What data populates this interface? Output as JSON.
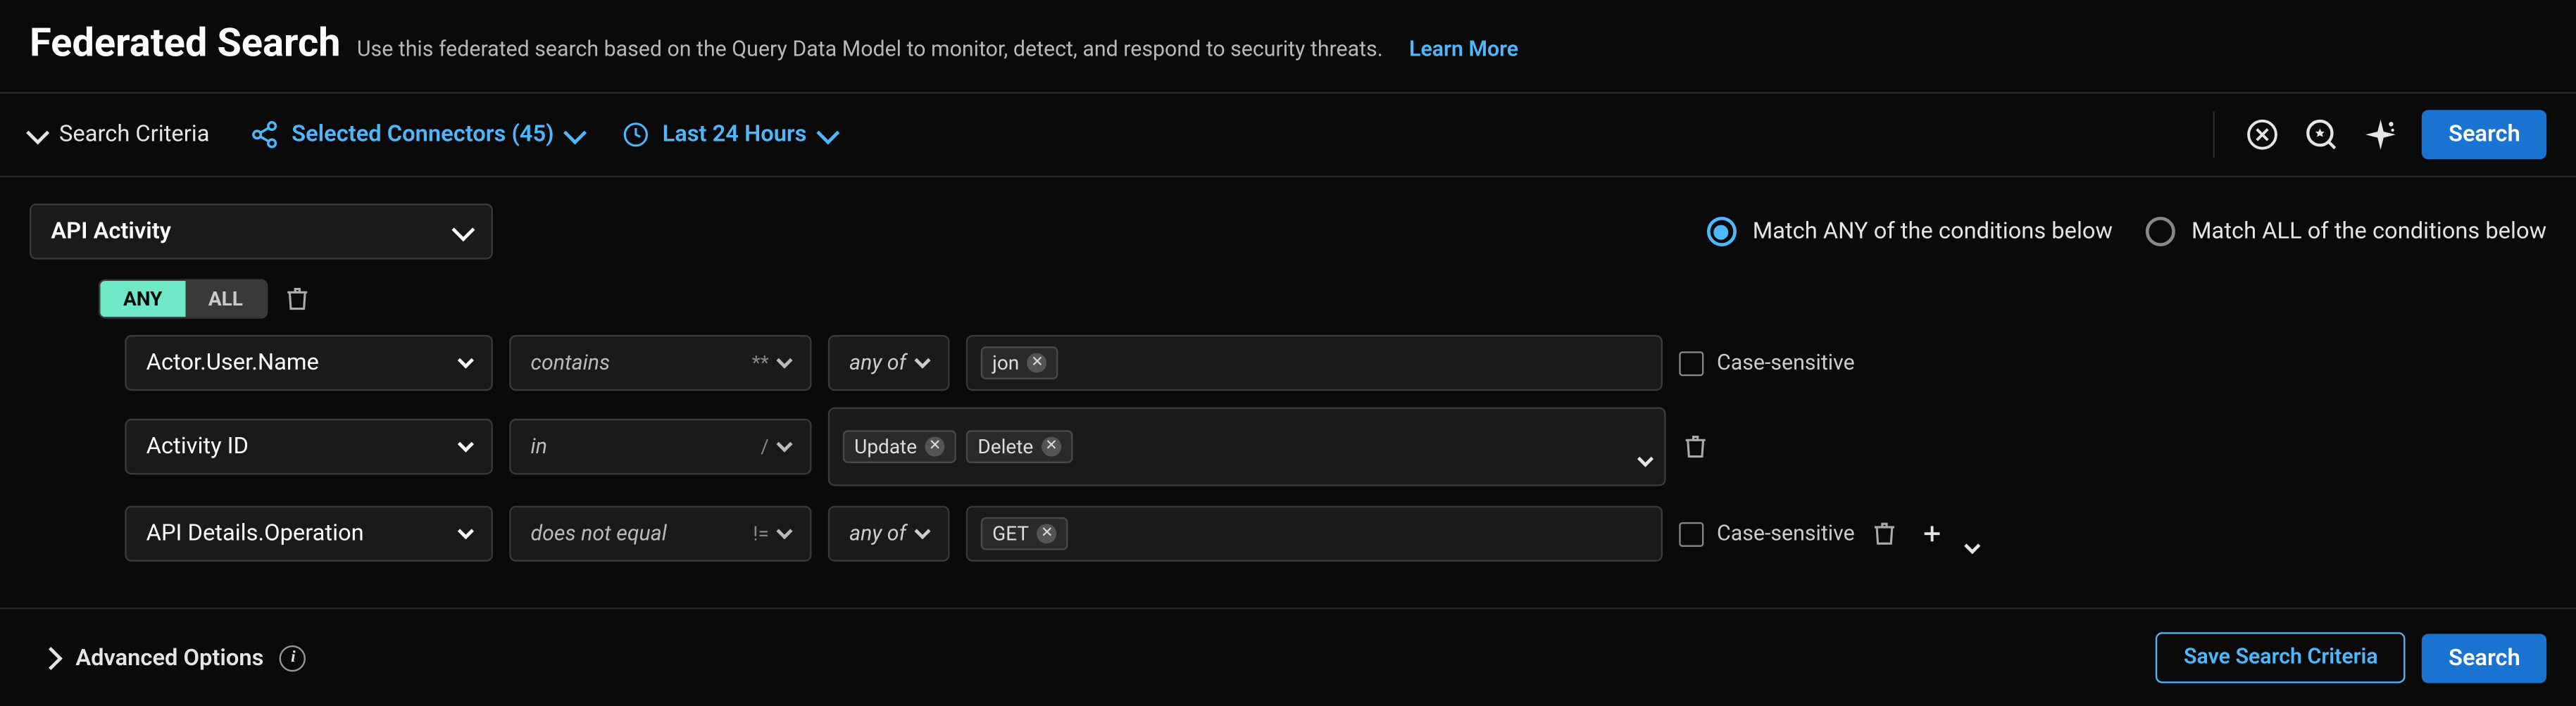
{
  "header": {
    "title": "Federated Search",
    "subtitle": "Use this federated search based on the Query Data Model to monitor, detect, and respond to security threats.",
    "learn_more": "Learn More"
  },
  "bar": {
    "search_criteria": "Search Criteria",
    "connectors": "Selected Connectors (45)",
    "time_range": "Last 24 Hours",
    "search_btn": "Search"
  },
  "criteria": {
    "activity_type": "API Activity",
    "match_any": "Match ANY of the conditions below",
    "match_all": "Match ALL of the conditions below",
    "match_mode": "any",
    "group_toggle": {
      "any": "ANY",
      "all": "ALL",
      "active": "any"
    },
    "rows": [
      {
        "field": "Actor.User.Name",
        "op": "contains",
        "sym": "**",
        "quantifier": "any of",
        "chips": [
          "jon"
        ],
        "case_label": "Case-sensitive",
        "show_case": true,
        "show_chips_caret": false,
        "show_trash": false,
        "show_add": false
      },
      {
        "field": "Activity ID",
        "op": "in",
        "sym": "/",
        "quantifier": null,
        "chips": [
          "Update",
          "Delete"
        ],
        "case_label": null,
        "show_case": false,
        "show_chips_caret": true,
        "show_trash": true,
        "show_add": false
      },
      {
        "field": "API Details.Operation",
        "op": "does not equal",
        "sym": "!=",
        "quantifier": "any of",
        "chips": [
          "GET"
        ],
        "case_label": "Case-sensitive",
        "show_case": true,
        "show_chips_caret": false,
        "show_trash": true,
        "show_add": true
      }
    ]
  },
  "footer": {
    "advanced": "Advanced Options",
    "save": "Save Search Criteria",
    "search": "Search"
  }
}
